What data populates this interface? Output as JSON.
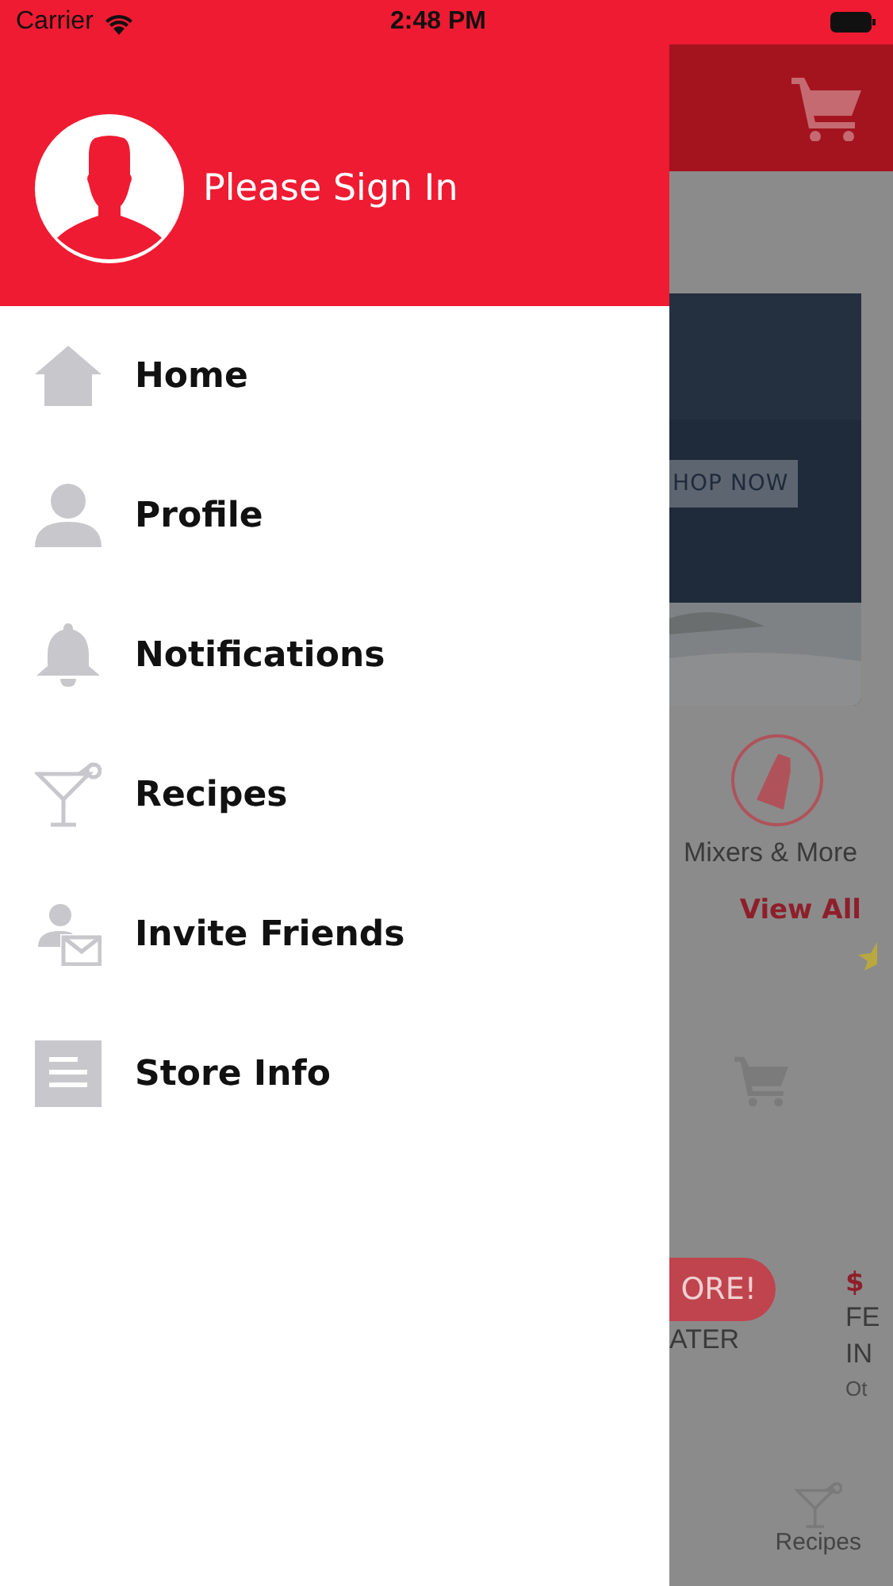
{
  "status_bar": {
    "carrier": "Carrier",
    "time": "2:48 PM"
  },
  "drawer": {
    "header": {
      "title": "Please Sign In"
    },
    "items": [
      {
        "label": "Home",
        "kind": "home"
      },
      {
        "label": "Profile",
        "kind": "person"
      },
      {
        "label": "Notifications",
        "kind": "bell"
      },
      {
        "label": "Recipes",
        "kind": "cocktail"
      },
      {
        "label": "Invite Friends",
        "kind": "invite"
      },
      {
        "label": "Store Info",
        "kind": "document"
      }
    ]
  },
  "background": {
    "banner_button": "HOP NOW",
    "category": "Mixers & More",
    "view_all": "View All",
    "product_left": {
      "badge": "ORE!",
      "name": "ATER"
    },
    "product_right": {
      "price": "$",
      "name_lines": [
        "FE",
        "IN"
      ],
      "meta": "Ot"
    },
    "tab": "Recipes"
  }
}
